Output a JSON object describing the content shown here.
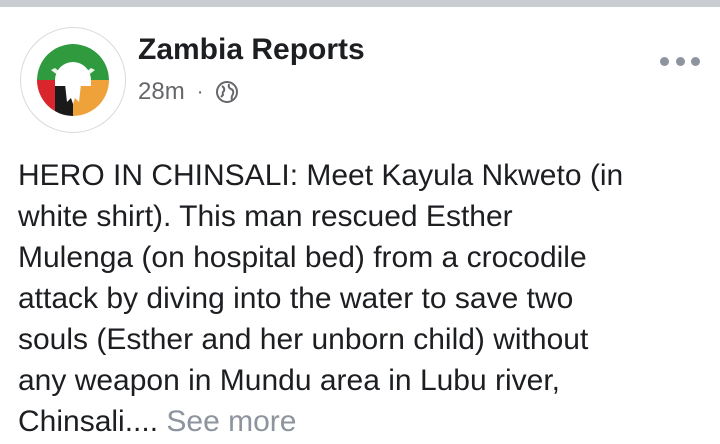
{
  "post": {
    "page_name": "Zambia Reports",
    "time": "28m",
    "separator": "·",
    "privacy_icon": "globe-icon",
    "more_icon": "more-options-icon",
    "body_lines": [
      "HERO IN CHINSALI: Meet Kayula Nkweto (in",
      "white shirt). This man rescued Esther",
      "Mulenga (on hospital bed) from a crocodile",
      "attack by diving into the water to save two",
      "souls (Esther and her unborn child) without",
      "any weapon in Mundu area in Lubu river,",
      "Chinsali...."
    ],
    "see_more": "See more"
  },
  "colors": {
    "text": "#1c1e21",
    "secondary": "#65676b",
    "muted": "#8d949e",
    "logo_green": "#2f9a3e",
    "logo_red": "#d9262c",
    "logo_orange": "#f0a23a",
    "logo_black": "#1a1a1a"
  }
}
